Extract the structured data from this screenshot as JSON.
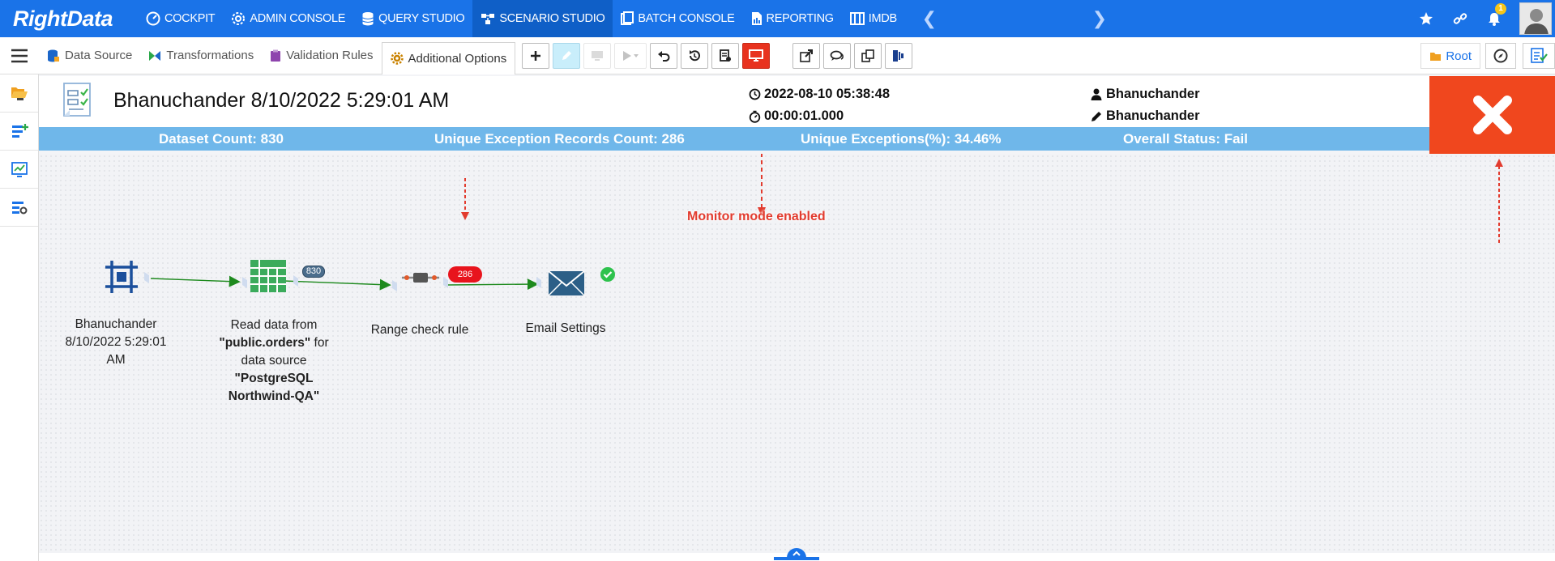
{
  "app": {
    "logo": "RightData"
  },
  "nav": {
    "items": [
      {
        "label": "COCKPIT",
        "icon": "cockpit-icon"
      },
      {
        "label": "ADMIN CONSOLE",
        "icon": "gear-icon"
      },
      {
        "label": "QUERY STUDIO",
        "icon": "database-icon"
      },
      {
        "label": "SCENARIO STUDIO",
        "icon": "scenario-icon",
        "active": true
      },
      {
        "label": "BATCH CONSOLE",
        "icon": "batch-icon"
      },
      {
        "label": "REPORTING",
        "icon": "report-icon"
      },
      {
        "label": "IMDB",
        "icon": "imdb-icon"
      }
    ],
    "notification_count": "1"
  },
  "toolbar": {
    "tabs": [
      {
        "label": "Data Source",
        "icon": "data-source-icon"
      },
      {
        "label": "Transformations",
        "icon": "transformations-icon"
      },
      {
        "label": "Validation Rules",
        "icon": "validation-rules-icon"
      },
      {
        "label": "Additional Options",
        "icon": "additional-options-icon",
        "selected": true
      }
    ],
    "root_label": "Root"
  },
  "header": {
    "title": "Bhanuchander 8/10/2022 5:29:01 AM",
    "run_datetime": "2022-08-10 05:38:48",
    "duration": "00:00:01.000",
    "created_by": "Bhanuchander",
    "modified_by": "Bhanuchander"
  },
  "stats": {
    "dataset_count": "Dataset Count: 830",
    "unique_exception_records": "Unique Exception Records Count: 286",
    "unique_exceptions_pct": "Unique Exceptions(%): 34.46%",
    "overall_status": "Overall Status: Fail",
    "status_color": "#f0471e"
  },
  "flow": {
    "nodes": [
      {
        "label_lines": [
          "Bhanuchander",
          "8/10/2022 5:29:01",
          "AM"
        ]
      },
      {
        "label_parts": [
          "Read data from",
          "\"public.orders\"",
          "for",
          "data source",
          "\"PostgreSQL",
          "Northwind-QA\""
        ]
      },
      {
        "label": "Range check rule"
      },
      {
        "label": "Email Settings"
      }
    ],
    "badges": {
      "record_count": "830",
      "exception_count": "286"
    }
  },
  "annotations": {
    "monitor_mode": "Monitor mode enabled"
  },
  "colors": {
    "brand": "#1a73e8",
    "stats_bar": "#6fb7ea",
    "fail": "#f0471e",
    "edge": "#1e8a1e"
  }
}
